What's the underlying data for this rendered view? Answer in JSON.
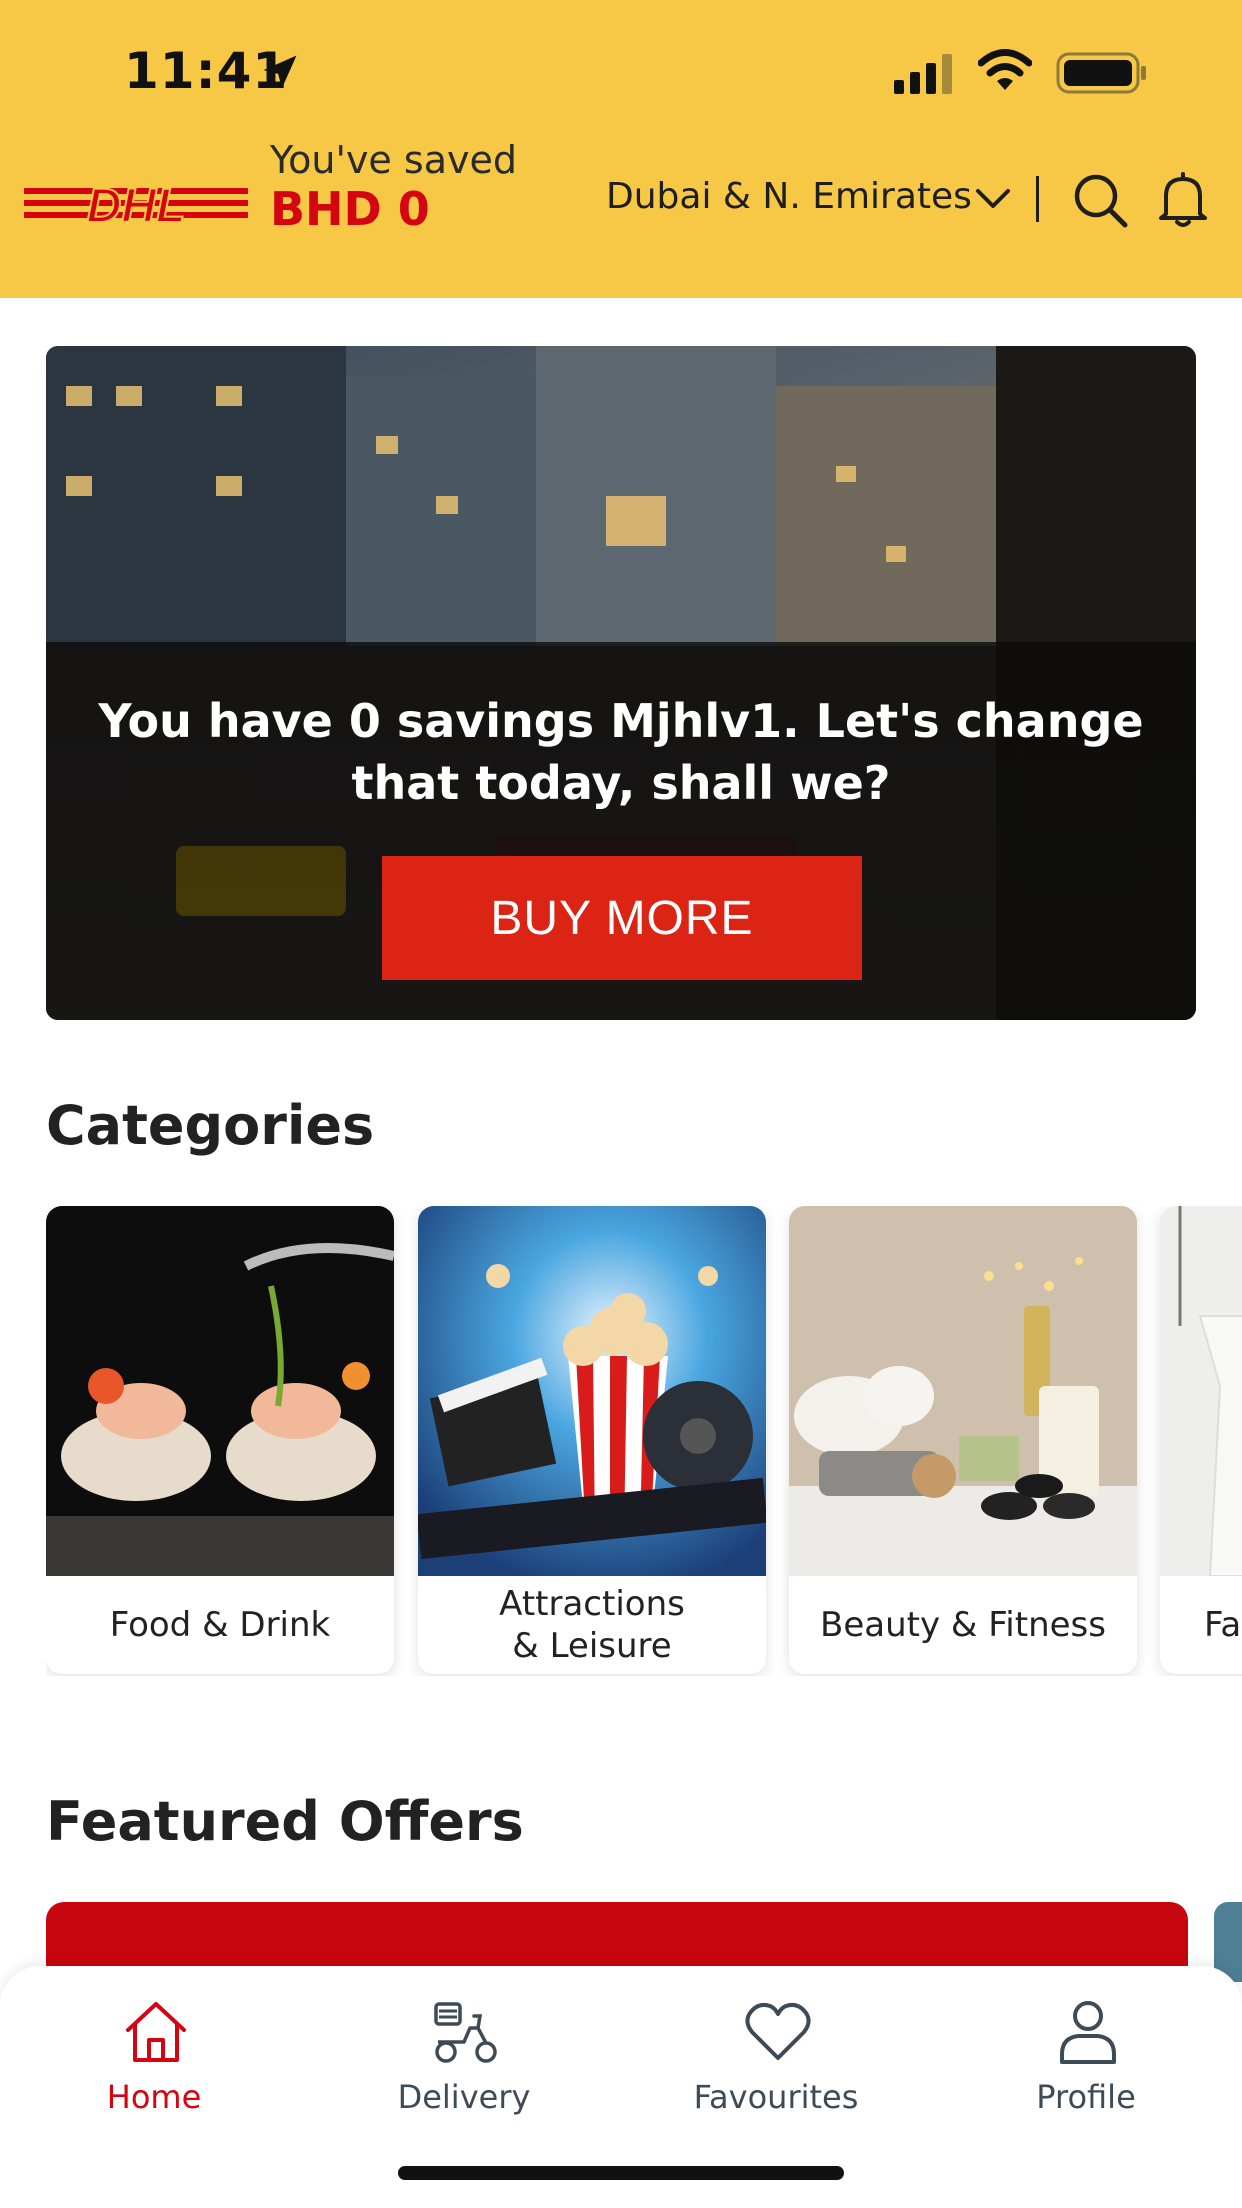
{
  "status_bar": {
    "time": "11:41",
    "icons": [
      "location-arrow-icon",
      "signal-icon",
      "wifi-icon",
      "battery-icon"
    ]
  },
  "header": {
    "logo": "DHL",
    "saved_label": "You've saved",
    "saved_amount": "BHD 0",
    "region": "Dubai & N. Emirates",
    "icons": [
      "chevron-down-icon",
      "search-icon",
      "bell-icon"
    ],
    "brand_yellow": "#f6c845",
    "brand_red": "#d40511"
  },
  "banner": {
    "message": "You have 0 savings Mjhlv1. Let's change that today, shall we?",
    "button_label": "BUY MORE",
    "button_color": "#db2414"
  },
  "categories": {
    "title": "Categories",
    "items": [
      {
        "label": "Food & Drink"
      },
      {
        "label": "Attractions\n& Leisure"
      },
      {
        "label": "Beauty & Fitness"
      },
      {
        "label": "Fa"
      }
    ]
  },
  "featured": {
    "title": "Featured Offers"
  },
  "tabbar": {
    "items": [
      {
        "label": "Home",
        "icon": "home-icon",
        "active": true
      },
      {
        "label": "Delivery",
        "icon": "scooter-icon",
        "active": false
      },
      {
        "label": "Favourites",
        "icon": "heart-icon",
        "active": false
      },
      {
        "label": "Profile",
        "icon": "person-icon",
        "active": false
      }
    ]
  }
}
